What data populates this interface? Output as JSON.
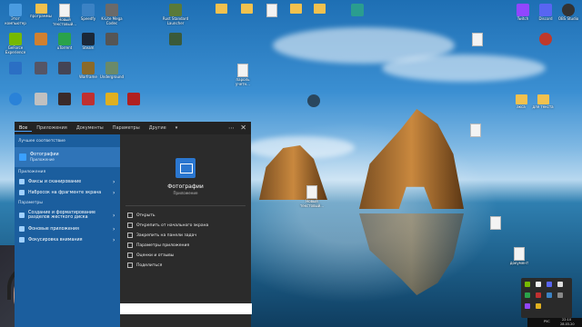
{
  "desktop_icons": [
    {
      "label": "Этот компьютер",
      "kind": "app"
    },
    {
      "label": "программы",
      "kind": "folder"
    },
    {
      "label": "Новый текстовый...",
      "kind": "file"
    },
    {
      "label": "Speedfy",
      "kind": "app"
    },
    {
      "label": "K-Lite Mega Codec",
      "kind": "app"
    },
    {
      "label": "Rust Standard Launcher",
      "kind": "app"
    },
    {
      "label": "Twitch",
      "kind": "app"
    },
    {
      "label": "Discord",
      "kind": "app"
    },
    {
      "label": "OBS Studio",
      "kind": "app"
    },
    {
      "label": "GeForce Experience",
      "kind": "app"
    },
    {
      "label": "uTorrent",
      "kind": "app"
    },
    {
      "label": "Steam",
      "kind": "app"
    },
    {
      "label": "Warframe",
      "kind": "app"
    },
    {
      "label": "Underground",
      "kind": "app"
    },
    {
      "label": "акса",
      "kind": "folder"
    },
    {
      "label": "для текста",
      "kind": "folder"
    },
    {
      "label": "пароль учетн...",
      "kind": "file"
    },
    {
      "label": "Новый текстовый...",
      "kind": "file"
    },
    {
      "label": "документ",
      "kind": "file"
    }
  ],
  "start_menu": {
    "tabs": [
      "Все",
      "Приложения",
      "Документы",
      "Параметры",
      "Другие"
    ],
    "more": "⋯",
    "close": "✕",
    "best_match_title": "Лучшее соответствие",
    "best_match": {
      "name": "Фотографии",
      "sub": "Приложение"
    },
    "apps_title": "Приложения",
    "apps": [
      {
        "label": "Факсы и сканирование"
      },
      {
        "label": "Набросок на фрагменте экрана"
      }
    ],
    "settings_title": "Параметры",
    "settings": [
      {
        "label": "Создание и форматирование разделов жесткого диска"
      },
      {
        "label": "Фоновые приложения"
      },
      {
        "label": "Фокусировка внимания"
      }
    ],
    "preview": {
      "name": "Фотографии",
      "type": "Приложение",
      "actions": [
        "Открыть",
        "Открепить от начального экрана",
        "Закрепить на панели задач",
        "Параметры приложения",
        "Оценки и отзывы",
        "Поделиться"
      ]
    }
  },
  "taskbar": {
    "lang": "РУС",
    "time": "22:10",
    "date": "28.03.20"
  }
}
